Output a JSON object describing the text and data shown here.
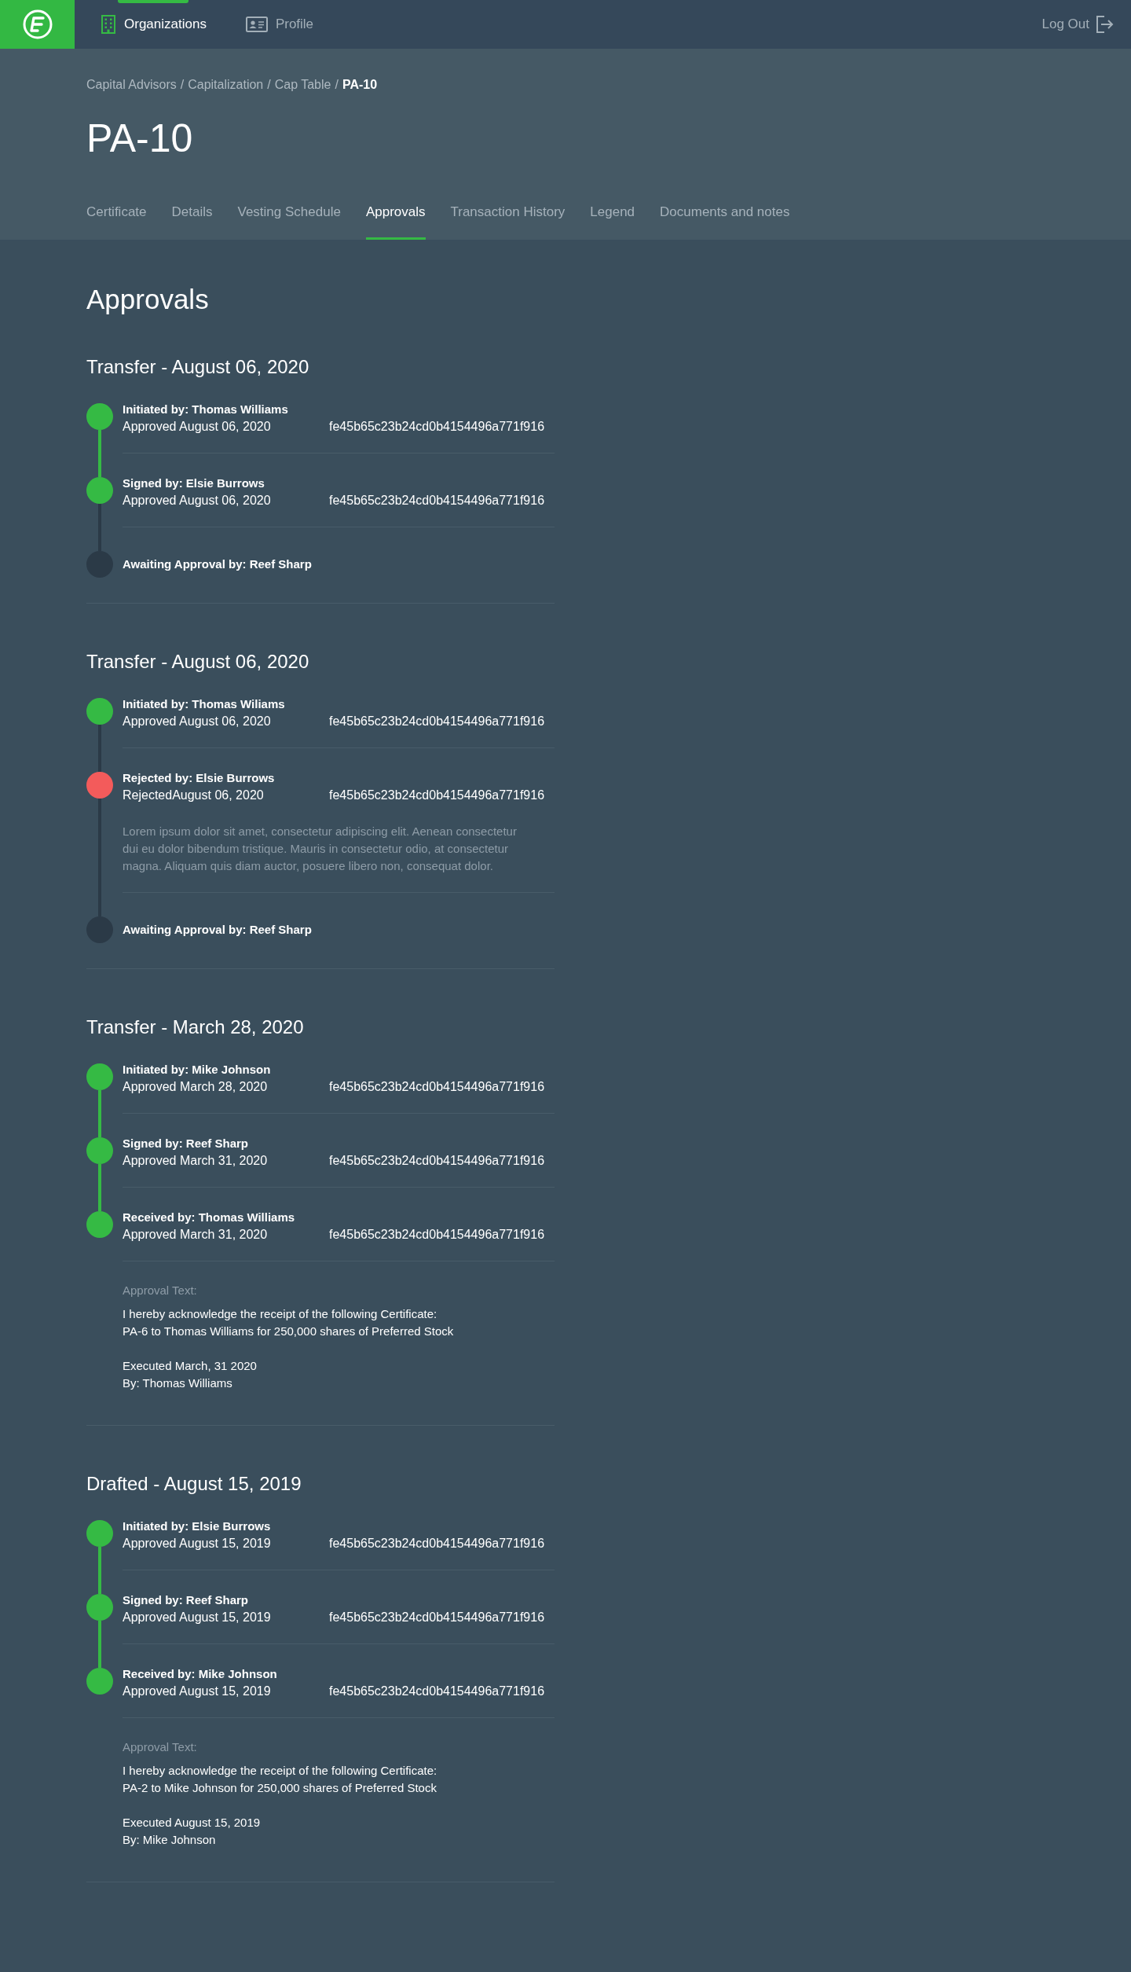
{
  "nav": {
    "items": [
      {
        "label": "Organizations",
        "selected": true
      },
      {
        "label": "Profile",
        "selected": false
      }
    ],
    "logout": "Log Out"
  },
  "breadcrumb": [
    {
      "label": "Capital Advisors",
      "separator": "/",
      "selected": false
    },
    {
      "label": "Capitalization",
      "separator": "/",
      "selected": false
    },
    {
      "label": "Cap Table",
      "separator": "/",
      "selected": false
    },
    {
      "label": "PA-10",
      "selected": true
    }
  ],
  "title": "PA-10",
  "tabs": [
    {
      "label": "Certificate",
      "selected": false
    },
    {
      "label": "Details",
      "selected": false
    },
    {
      "label": "Vesting Schedule",
      "selected": false
    },
    {
      "label": "Approvals",
      "selected": true
    },
    {
      "label": "Transaction History",
      "selected": false
    },
    {
      "label": "Legend",
      "selected": false
    },
    {
      "label": "Documents and notes",
      "selected": false
    }
  ],
  "heading": "Approvals",
  "groups": [
    {
      "title": "Transfer - August 06, 2020",
      "steps": [
        {
          "kind": "approved",
          "label": "Initiated by: Thomas Williams",
          "date": "Approved August 06, 2020",
          "hash": "fe45b65c23b24cd0b4154496a771f916"
        },
        {
          "kind": "approved",
          "label": "Signed by: Elsie Burrows",
          "date": "Approved August 06, 2020",
          "hash": "fe45b65c23b24cd0b4154496a771f916"
        },
        {
          "kind": "pending",
          "label": "Awaiting Approval by: Reef Sharp"
        }
      ]
    },
    {
      "title": "Transfer - August 06, 2020",
      "steps": [
        {
          "kind": "approved",
          "label": "Initiated by: Thomas Wiliams",
          "date": "Approved August 06, 2020",
          "hash": "fe45b65c23b24cd0b4154496a771f916"
        },
        {
          "kind": "rejected",
          "label": "Rejected by: Elsie Burrows",
          "date": "RejectedAugust 06, 2020",
          "hash": "fe45b65c23b24cd0b4154496a771f916",
          "comment": "Lorem ipsum dolor sit amet, consectetur adipiscing elit. Aenean consectetur dui eu dolor bibendum tristique. Mauris in consectetur odio, at consectetur magna. Aliquam quis diam auctor, posuere libero non, consequat dolor."
        },
        {
          "kind": "pending",
          "label": "Awaiting Approval by: Reef Sharp"
        }
      ]
    },
    {
      "title": "Transfer - March 28, 2020",
      "steps": [
        {
          "kind": "approved",
          "label": "Initiated by: Mike Johnson",
          "date": "Approved March 28, 2020",
          "hash": "fe45b65c23b24cd0b4154496a771f916"
        },
        {
          "kind": "approved",
          "label": "Signed by: Reef Sharp",
          "date": "Approved March 31, 2020",
          "hash": "fe45b65c23b24cd0b4154496a771f916"
        },
        {
          "kind": "approved",
          "label": "Received by: Thomas Williams",
          "date": "Approved March 31, 2020",
          "hash": "fe45b65c23b24cd0b4154496a771f916"
        }
      ],
      "approval_text": {
        "label": "Approval Text:",
        "paragraphs": [
          "I hereby acknowledge the receipt of the following Certificate:\nPA-6 to Thomas Williams for 250,000 shares of Preferred Stock",
          "Executed March, 31 2020\nBy: Thomas Williams"
        ]
      }
    },
    {
      "title": "Drafted - August 15, 2019",
      "steps": [
        {
          "kind": "approved",
          "label": "Initiated by: Elsie Burrows",
          "date": "Approved August 15, 2019",
          "hash": "fe45b65c23b24cd0b4154496a771f916"
        },
        {
          "kind": "approved",
          "label": "Signed by: Reef Sharp",
          "date": "Approved August 15, 2019",
          "hash": "fe45b65c23b24cd0b4154496a771f916"
        },
        {
          "kind": "approved",
          "label": "Received by: Mike Johnson",
          "date": "Approved August 15, 2019",
          "hash": "fe45b65c23b24cd0b4154496a771f916"
        }
      ],
      "approval_text": {
        "label": "Approval Text:",
        "paragraphs": [
          "I hereby acknowledge the receipt of the following Certificate:\nPA-2 to Mike Johnson for 250,000 shares of Preferred Stock",
          "Executed August 15, 2019\nBy: Mike Johnson"
        ]
      }
    }
  ]
}
